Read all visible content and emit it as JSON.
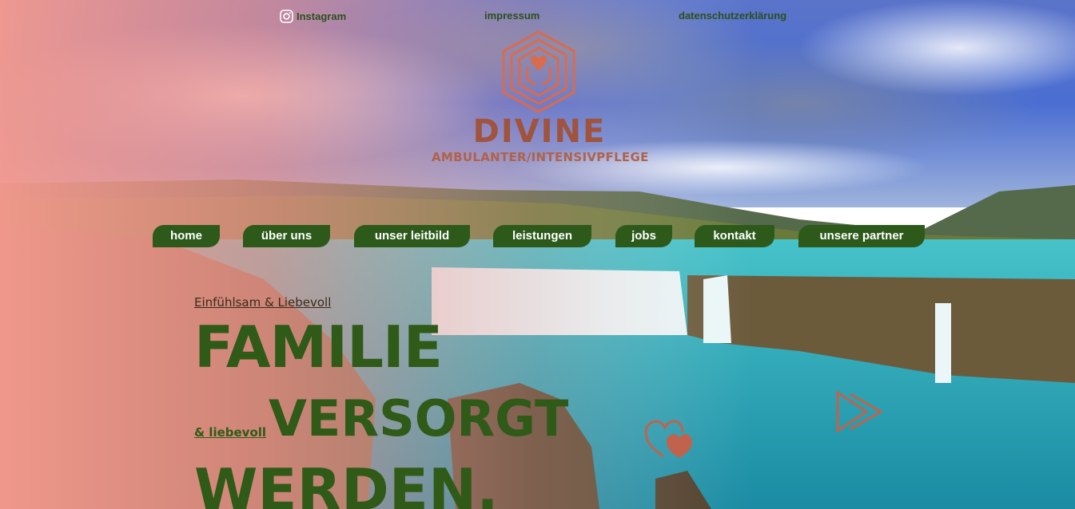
{
  "topbar": {
    "instagram_label": "Instagram",
    "impressum_label": "impressum",
    "privacy_label": "datenschutzerklärung"
  },
  "logo": {
    "name": "DIVINE",
    "subtitle": "AMBULANTER/INTENSIVPFLEGE"
  },
  "nav": {
    "items": [
      {
        "label": "home"
      },
      {
        "label": "über uns"
      },
      {
        "label": "unser leitbild"
      },
      {
        "label": "leistungen"
      },
      {
        "label": "jobs"
      },
      {
        "label": "kontakt"
      },
      {
        "label": "unsere partner"
      }
    ]
  },
  "hero": {
    "kicker": "Einfühlsam & Liebevoll",
    "headline_line1": "FAMILIE",
    "small_link": "& liebevoll",
    "headline_line2": "VERSORGT",
    "headline_line3": "WERDEN."
  },
  "colors": {
    "nav_bg": "#2d5a1b",
    "headline": "#2f5a17",
    "brand": "#a0533d",
    "accent": "#c0634d"
  },
  "icons": [
    "instagram-icon",
    "heart-icon",
    "play-icon",
    "logo-mark-icon"
  ]
}
